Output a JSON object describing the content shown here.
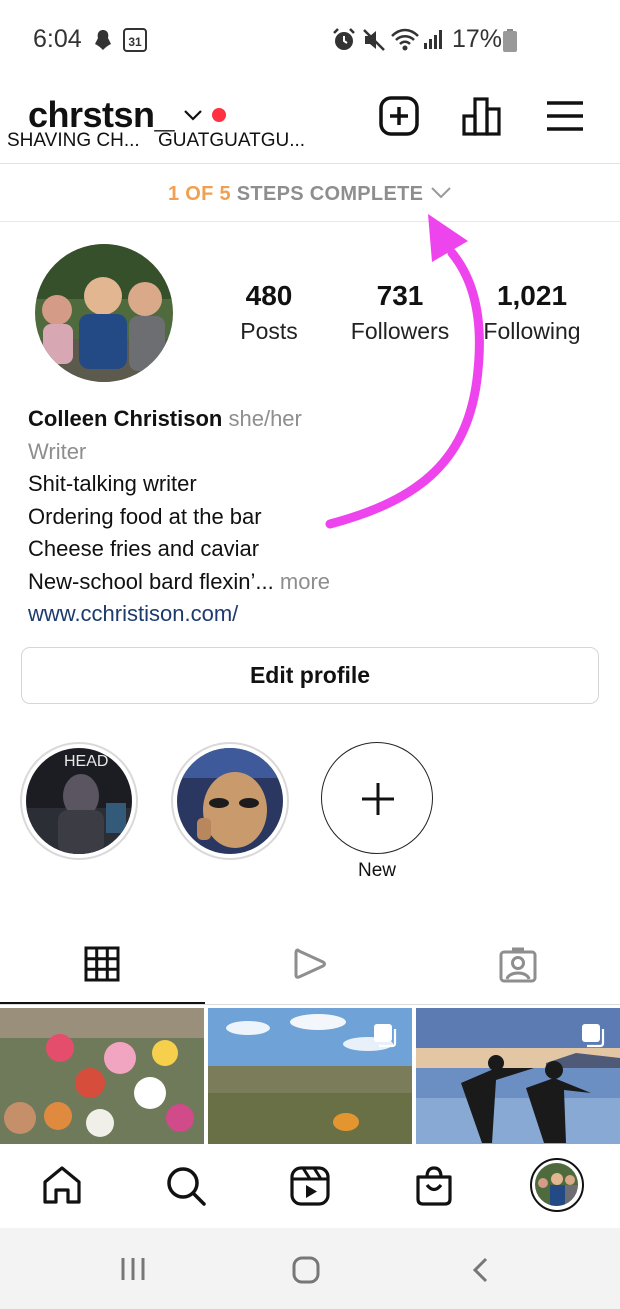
{
  "status_bar": {
    "time": "6:04",
    "calendar_day": "31",
    "battery": "17%"
  },
  "header": {
    "username": "chrstsn_",
    "icons": [
      "chevron-down-icon",
      "notification-dot",
      "new-post-icon",
      "insights-icon",
      "menu-icon"
    ]
  },
  "steps": {
    "progress": "1 OF 5",
    "label": "STEPS COMPLETE"
  },
  "profile": {
    "stats": [
      {
        "value": "480",
        "label": "Posts"
      },
      {
        "value": "731",
        "label": "Followers"
      },
      {
        "value": "1,021",
        "label": "Following"
      }
    ],
    "name": "Colleen Christison",
    "pronouns": "she/her",
    "category": "Writer",
    "bio_lines": [
      "Shit-talking writer",
      "Ordering food at the bar",
      "Cheese fries and caviar",
      "New-school bard flexin’..."
    ],
    "more": "more",
    "website": "www.cchristison.com/",
    "edit_button": "Edit profile"
  },
  "highlights": [
    {
      "label": "SHAVING CH...",
      "overlay_text": "HEAD"
    },
    {
      "label": "GUATGUATGU..."
    }
  ],
  "new_highlight_label": "New",
  "tabs": [
    "grid-icon",
    "reels-icon",
    "tagged-icon"
  ],
  "bottom_nav": [
    "home-icon",
    "search-icon",
    "reels-icon",
    "shop-icon",
    "profile-avatar"
  ],
  "colors": {
    "accent_orange": "#f0a050",
    "notification_red": "#ff3040",
    "annotation_magenta": "#ee44ee",
    "link_blue": "#1d3a6e"
  }
}
